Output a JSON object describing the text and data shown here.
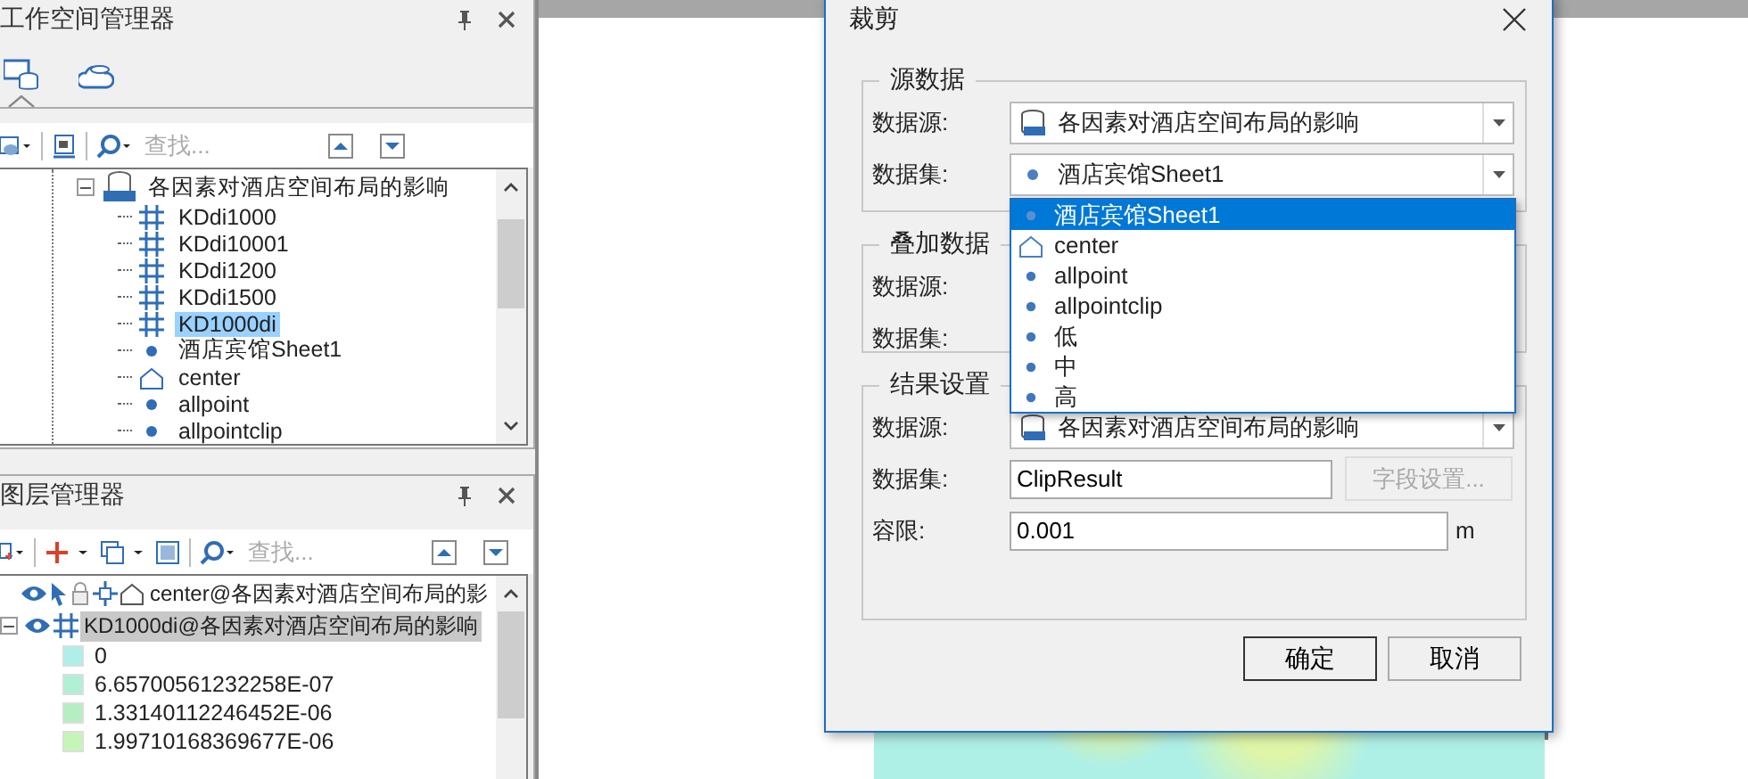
{
  "workspace_manager": {
    "title": "工作空间管理器",
    "tabs": [
      {
        "selected": true
      },
      {
        "selected": false
      }
    ],
    "search": {
      "placeholder": "查找..."
    },
    "tree": [
      {
        "label": "各因素对酒店空间布局的影响",
        "kind": "datasource",
        "expanded": true,
        "selected": false,
        "children": [
          {
            "label": "KDdi1000",
            "kind": "grid",
            "selected": false
          },
          {
            "label": "KDdi10001",
            "kind": "grid",
            "selected": false
          },
          {
            "label": "KDdi1200",
            "kind": "grid",
            "selected": false
          },
          {
            "label": "KDdi1500",
            "kind": "grid",
            "selected": false
          },
          {
            "label": "KD1000di",
            "kind": "grid",
            "selected": true
          },
          {
            "label": "酒店宾馆Sheet1",
            "kind": "point",
            "selected": false
          },
          {
            "label": "center",
            "kind": "region",
            "selected": false
          },
          {
            "label": "allpoint",
            "kind": "point",
            "selected": false
          },
          {
            "label": "allpointclip",
            "kind": "point",
            "selected": false
          }
        ]
      }
    ]
  },
  "layer_manager": {
    "title": "图层管理器",
    "search": {
      "placeholder": "查找..."
    },
    "layers": [
      {
        "label": "center@各因素对酒店空间布局的影",
        "kind": "region",
        "visible": true,
        "selected": false
      },
      {
        "label": "KD1000di@各因素对酒店空间布局的影响",
        "kind": "grid",
        "visible": true,
        "expanded": true,
        "selected": true,
        "legend": [
          {
            "label": "0",
            "color": "#aeefe9"
          },
          {
            "label": "6.65700561232258E-07",
            "color": "#b0f0d6"
          },
          {
            "label": "1.33140112246452E-06",
            "color": "#b4eec2"
          },
          {
            "label": "1.99710168369677E-06",
            "color": "#c6f5b8"
          }
        ]
      }
    ]
  },
  "dialog": {
    "title": "裁剪",
    "groups": [
      {
        "title": "源数据",
        "rows": [
          {
            "label": "数据源:",
            "kind": "source",
            "value": "各因素对酒店空间布局的影响"
          },
          {
            "label": "数据集:",
            "kind": "dataset",
            "value": "酒店宾馆Sheet1"
          }
        ]
      },
      {
        "title": "叠加数据",
        "rows": [
          {
            "label": "数据源:",
            "kind": "source"
          },
          {
            "label": "数据集:",
            "kind": "dataset"
          }
        ]
      },
      {
        "title": "结果设置",
        "rows": [
          {
            "label": "数据源:",
            "kind": "source",
            "value": "各因素对酒店空间布局的影响"
          },
          {
            "label": "数据集:",
            "kind": "input",
            "value": "ClipResult",
            "button": {
              "label": "字段设置...",
              "disabled": true
            }
          },
          {
            "label": "容限:",
            "kind": "input",
            "value": "0.001",
            "unit": "m"
          }
        ]
      }
    ],
    "dropdown": [
      {
        "label": "酒店宾馆Sheet1",
        "kind": "point",
        "selected": true
      },
      {
        "label": "center",
        "kind": "region",
        "selected": false
      },
      {
        "label": "allpoint",
        "kind": "point",
        "selected": false
      },
      {
        "label": "allpointclip",
        "kind": "point",
        "selected": false
      },
      {
        "label": "低",
        "kind": "point",
        "selected": false
      },
      {
        "label": "中",
        "kind": "point",
        "selected": false
      },
      {
        "label": "高",
        "kind": "point",
        "selected": false
      }
    ],
    "buttons": [
      {
        "label": "确定",
        "default": true
      },
      {
        "label": "取消",
        "default": false
      }
    ]
  }
}
